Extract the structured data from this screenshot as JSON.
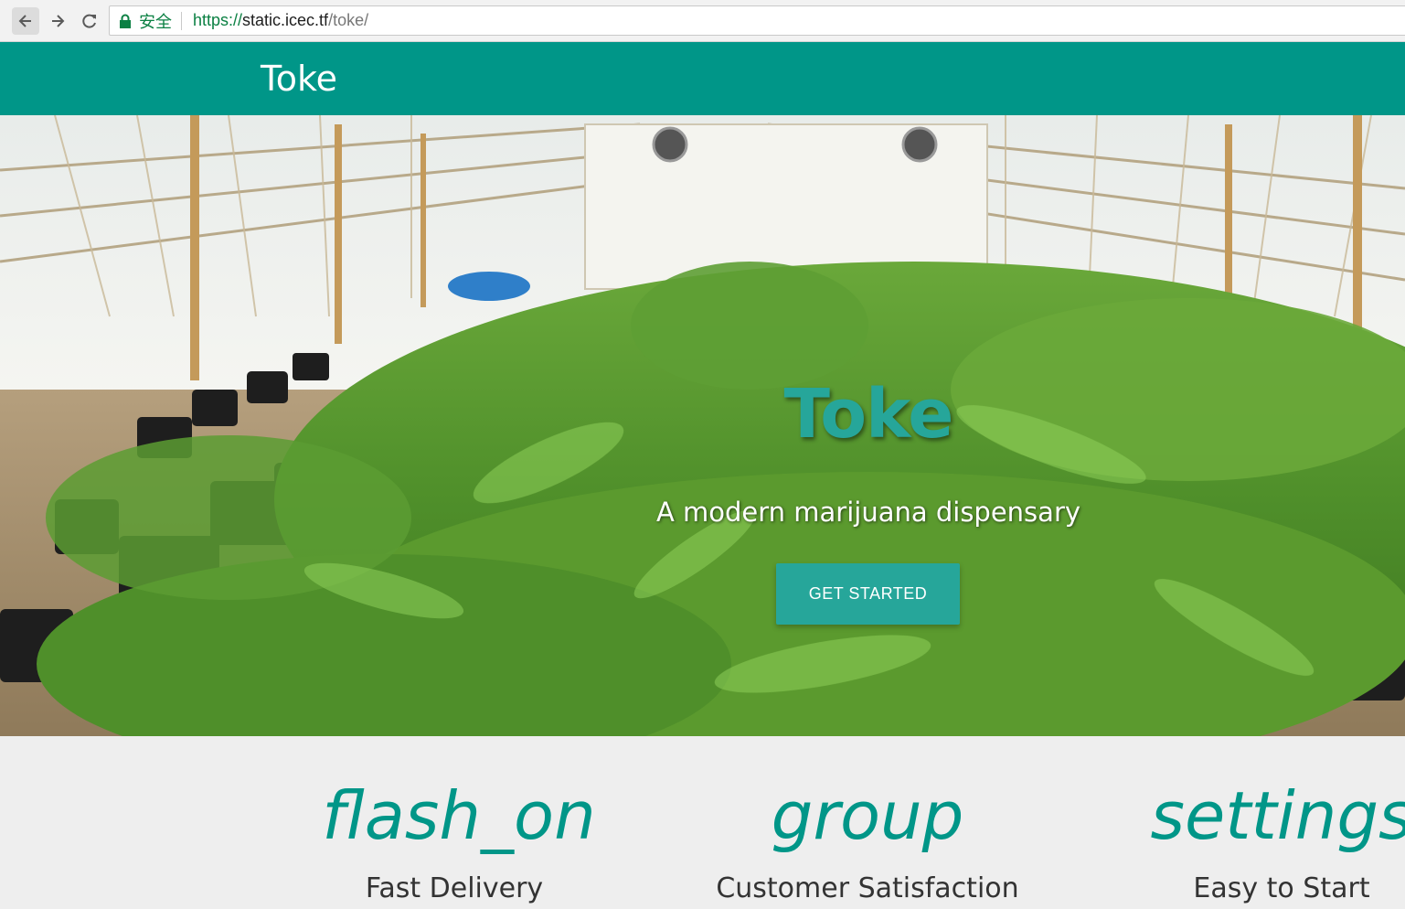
{
  "browser": {
    "secure_label": "安全",
    "url_scheme": "https://",
    "url_host": "static.icec.tf",
    "url_path": "/toke/"
  },
  "nav": {
    "brand": "Toke"
  },
  "hero": {
    "title": "Toke",
    "tagline": "A modern marijuana dispensary",
    "cta_label": "GET STARTED"
  },
  "features": [
    {
      "icon": "flash_on",
      "label": "Fast Delivery"
    },
    {
      "icon": "group",
      "label": "Customer Satisfaction"
    },
    {
      "icon": "settings",
      "label": "Easy to Start"
    }
  ],
  "colors": {
    "primary": "#009688",
    "accent": "#26a69a",
    "secure_green": "#0b8043"
  }
}
